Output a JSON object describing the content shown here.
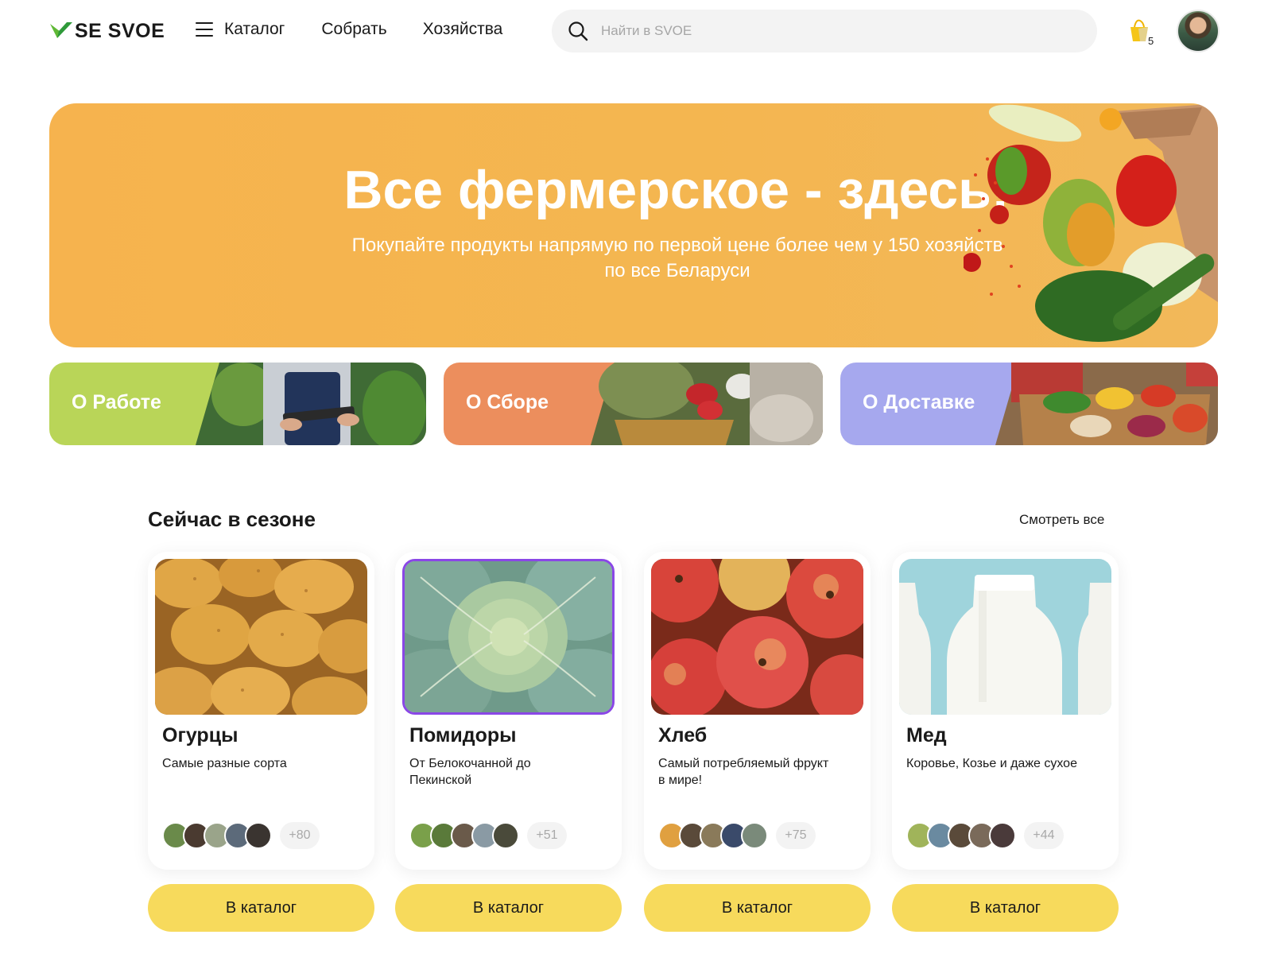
{
  "header": {
    "logo_text": "SE SVOE",
    "nav": {
      "catalog": "Каталог",
      "collect": "Собрать",
      "farms": "Хозяйства"
    },
    "search": {
      "placeholder": "Найти в SVOE",
      "value": ""
    },
    "cart": {
      "count": "5"
    }
  },
  "hero": {
    "title": "Все фермерское - здесь!",
    "subtitle": "Покупайте продукты напрямую по первой цене  более чем у 150 хозяйств по все Беларуси"
  },
  "tiles": [
    {
      "label": "О Работе"
    },
    {
      "label": "О Сборе"
    },
    {
      "label": "О Доставке"
    }
  ],
  "season": {
    "title": "Сейчас в сезоне",
    "see_all": "Смотреть все",
    "cards": [
      {
        "title": "Огурцы",
        "desc": "Самые разные сорта",
        "more": "+80",
        "button": "В каталог"
      },
      {
        "title": "Помидоры",
        "desc": "От Белокочанной до Пекинской",
        "more": "+51",
        "button": "В каталог"
      },
      {
        "title": "Хлеб",
        "desc": "Самый потребляемый фрукт в мире!",
        "more": "+75",
        "button": "В каталог"
      },
      {
        "title": "Мед",
        "desc": "Коровье, Козье и даже сухое",
        "more": "+44",
        "button": "В каталог"
      }
    ]
  },
  "colors": {
    "accent_yellow": "#f7da5c",
    "hero_orange": "#f6b34e",
    "tile_green": "#b9d558",
    "tile_orange": "#ec8e5d",
    "tile_purple": "#a6a8ee",
    "selected_border": "#8a47e6"
  },
  "icons": [
    "logo-check-icon",
    "burger-menu-icon",
    "search-icon",
    "cart-icon"
  ]
}
